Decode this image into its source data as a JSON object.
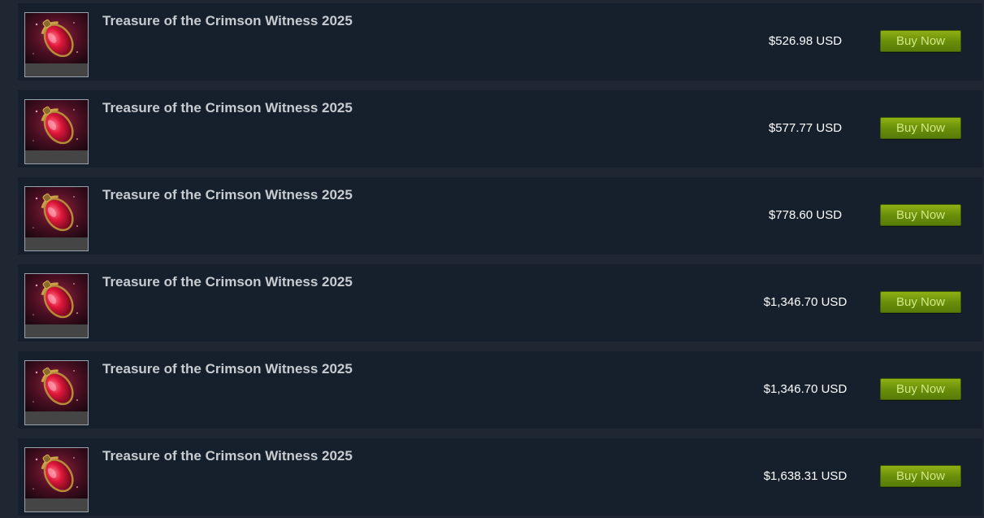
{
  "listings": [
    {
      "name": "Treasure of the Crimson Witness 2025",
      "price": "$526.98 USD",
      "buy_label": "Buy Now"
    },
    {
      "name": "Treasure of the Crimson Witness 2025",
      "price": "$577.77 USD",
      "buy_label": "Buy Now"
    },
    {
      "name": "Treasure of the Crimson Witness 2025",
      "price": "$778.60 USD",
      "buy_label": "Buy Now"
    },
    {
      "name": "Treasure of the Crimson Witness 2025",
      "price": "$1,346.70 USD",
      "buy_label": "Buy Now"
    },
    {
      "name": "Treasure of the Crimson Witness 2025",
      "price": "$1,346.70 USD",
      "buy_label": "Buy Now"
    },
    {
      "name": "Treasure of the Crimson Witness 2025",
      "price": "$1,638.31 USD",
      "buy_label": "Buy Now"
    }
  ],
  "colors": {
    "page_background": "#1f2733",
    "row_background": "#16202d",
    "name_text": "#c8ccd1",
    "price_text": "#ffffff",
    "buy_button": "#6a8f0a",
    "buy_button_text": "#d2e885"
  },
  "item_icon": "crimson-treasure-icon"
}
